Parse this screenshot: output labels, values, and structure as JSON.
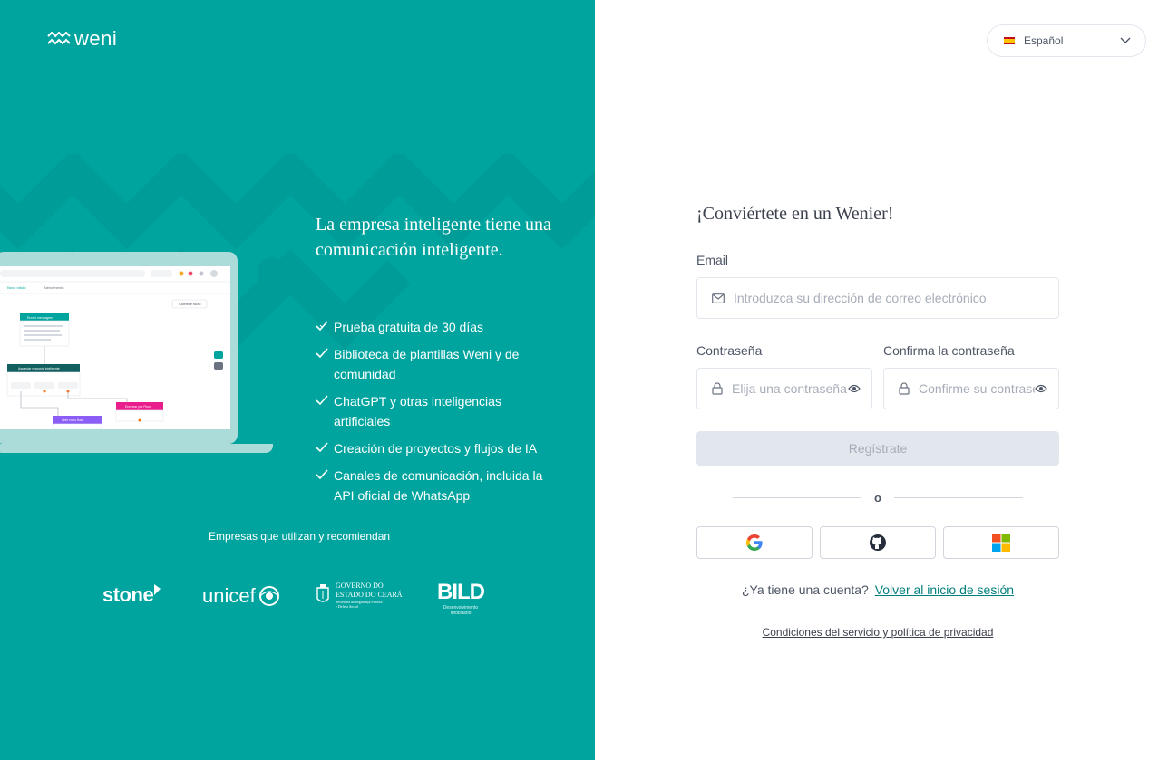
{
  "colors": {
    "brand": "#00A49F",
    "link": "#00807D",
    "text": "#4E5666",
    "border": "#E2E6ED",
    "button_disabled_bg": "#E2E6ED"
  },
  "brand": {
    "logo_text": "weni"
  },
  "promo": {
    "headline": "La empresa inteligente tiene una comunicación inteligente.",
    "features": [
      "Prueba gratuita de 30 días",
      "Biblioteca de plantillas Weni y de comunidad",
      "ChatGPT y otras inteligencias artificiales",
      "Creación de proyectos y flujos de IA",
      "Canales de comunicación, incluida la API oficial de WhatsApp"
    ],
    "companies_title": "Empresas que utilizan y recomiendan",
    "partners": {
      "stone": "stone",
      "unicef": "unicef",
      "ceara_line1": "GOVERNO DO",
      "ceara_line2": "ESTADO DO CEARÁ",
      "ceara_line3": "Secretaria da Segurança Pública",
      "ceara_line4": "e Defesa Social",
      "bild": "BILD",
      "bild_sub1": "Desenvolvimento",
      "bild_sub2": "Imobiliário"
    },
    "mockup": {
      "tab1": "Novo rótulo",
      "tab2": "Atendimento",
      "button": "Comece fluxo",
      "node1": "Enviar mensagem",
      "node2": "Aguardar resposta inteligente",
      "node3": "Abrir novo fluxo",
      "node4": "Enviar mensagem",
      "node5": "Encerrar por Fluxo"
    }
  },
  "language": {
    "selected": "Español",
    "icon": "chevron-down-icon"
  },
  "form": {
    "title": "¡Conviértete en un Wenier!",
    "email_label": "Email",
    "email_placeholder": "Introduzca su dirección de correo electrónico",
    "password_label": "Contraseña",
    "password_placeholder": "Elija una contraseña",
    "confirm_label": "Confirma la contraseña",
    "confirm_placeholder": "Confirme su contraseña",
    "submit": "Regístrate",
    "or": "o",
    "social": [
      "google-icon",
      "github-icon",
      "microsoft-icon"
    ],
    "have_account": "¿Ya tiene una cuenta?",
    "back_to_login": "Volver al inicio de sesión",
    "terms": "Condiciones del servicio y política de privacidad"
  }
}
